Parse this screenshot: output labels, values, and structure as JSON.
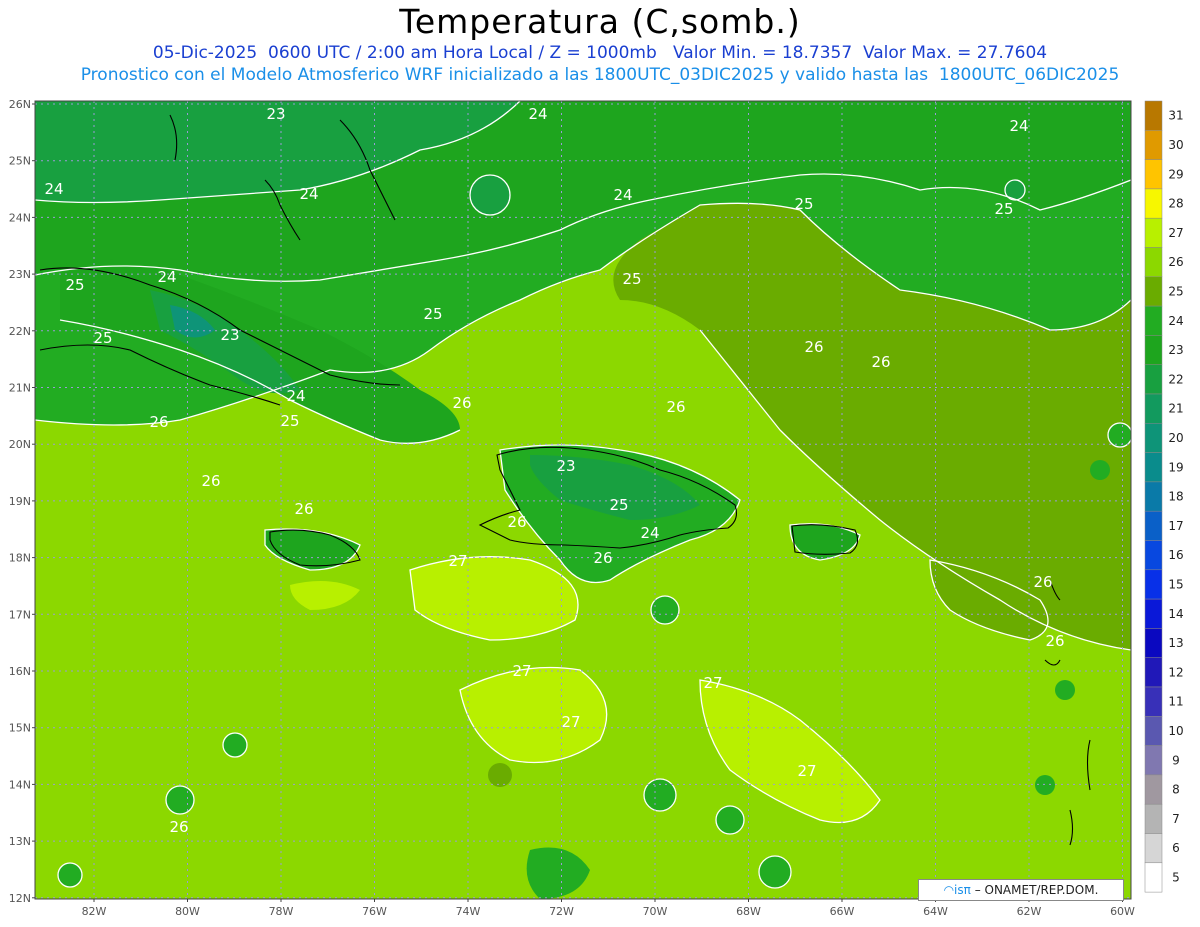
{
  "header": {
    "title": "Temperatura (C,somb.)",
    "line1": "05-Dic-2025  0600 UTC / 2:00 am Hora Local / Z = 1000mb   Valor Min. = 18.7357  Valor Max. = 27.7604",
    "line2": "Pronostico con el Modelo Atmosferico WRF inicializado a las 1800UTC_03DIC2025 y valido hasta las  1800UTC_06DIC2025"
  },
  "map": {
    "lat_labels": [
      "26N",
      "25N",
      "24N",
      "23N",
      "22N",
      "21N",
      "20N",
      "19N",
      "18N",
      "17N",
      "16N",
      "15N",
      "14N",
      "13N",
      "12N"
    ],
    "lon_labels": [
      "82W",
      "80W",
      "78W",
      "76W",
      "74W",
      "72W",
      "70W",
      "68W",
      "66W",
      "64W",
      "62W",
      "60W"
    ],
    "contour_labels": [
      {
        "text": "23"
      },
      {
        "text": "24"
      },
      {
        "text": "24"
      },
      {
        "text": "24"
      },
      {
        "text": "24"
      },
      {
        "text": "24"
      },
      {
        "text": "25"
      },
      {
        "text": "25"
      },
      {
        "text": "25"
      },
      {
        "text": "25"
      },
      {
        "text": "25"
      },
      {
        "text": "25"
      },
      {
        "text": "26"
      },
      {
        "text": "26"
      },
      {
        "text": "26"
      },
      {
        "text": "26"
      },
      {
        "text": "26"
      },
      {
        "text": "26"
      },
      {
        "text": "27"
      },
      {
        "text": "27"
      },
      {
        "text": "27"
      },
      {
        "text": "27"
      },
      {
        "text": "23"
      },
      {
        "text": "24"
      },
      {
        "text": "26"
      },
      {
        "text": "26"
      },
      {
        "text": "26"
      },
      {
        "text": "25"
      },
      {
        "text": "24"
      },
      {
        "text": "23"
      },
      {
        "text": "25"
      },
      {
        "text": "26"
      },
      {
        "text": "24"
      },
      {
        "text": "26"
      },
      {
        "text": "26"
      },
      {
        "text": "27"
      }
    ]
  },
  "colorbar": {
    "values": [
      "31",
      "30",
      "29",
      "28",
      "27",
      "26",
      "25",
      "24",
      "23",
      "22",
      "21",
      "20",
      "19",
      "18",
      "17",
      "16",
      "15",
      "14",
      "13",
      "12",
      "11",
      "10",
      "9",
      "8",
      "7",
      "6",
      "5"
    ],
    "colors": [
      "#b87800",
      "#e09a00",
      "#ffc400",
      "#f7f700",
      "#b8f000",
      "#8cd800",
      "#6aac00",
      "#22ac22",
      "#1ea51e",
      "#18a040",
      "#129a5e",
      "#0e9478",
      "#0a8c8c",
      "#0a7aa8",
      "#0a60c8",
      "#0848e0",
      "#0830e8",
      "#0a18d8",
      "#0a08c0",
      "#2018b8",
      "#3830b8",
      "#5a58b0",
      "#8078b0",
      "#a098a0",
      "#b4b4b4",
      "#d6d6d6",
      "#ffffff"
    ]
  },
  "credit": {
    "logo": "◠isπ",
    "text": "–  ONAMET/REP.DOM."
  }
}
